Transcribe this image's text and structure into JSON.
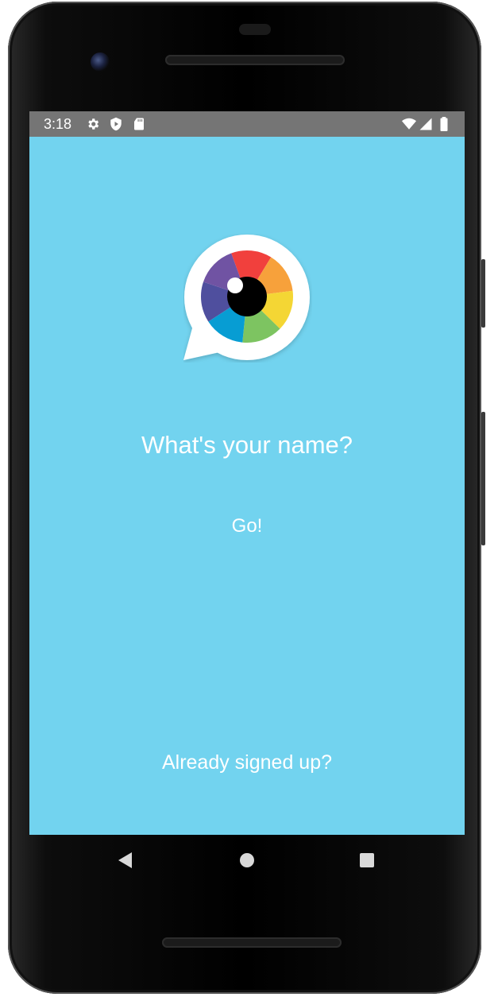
{
  "status_bar": {
    "time": "3:18",
    "left_icons": [
      "gear-icon",
      "shield-icon",
      "sd-card-icon"
    ],
    "right_icons": [
      "wifi-icon",
      "cell-signal-icon",
      "battery-icon"
    ]
  },
  "app": {
    "background_color": "#72d3ef",
    "logo_icon": "speech-bubble-eye-logo",
    "prompt": "What's your name?",
    "go_label": "Go!",
    "signed_up_label": "Already signed up?"
  },
  "nav_bar": {
    "buttons": [
      "back-icon",
      "home-icon",
      "recents-icon"
    ]
  }
}
